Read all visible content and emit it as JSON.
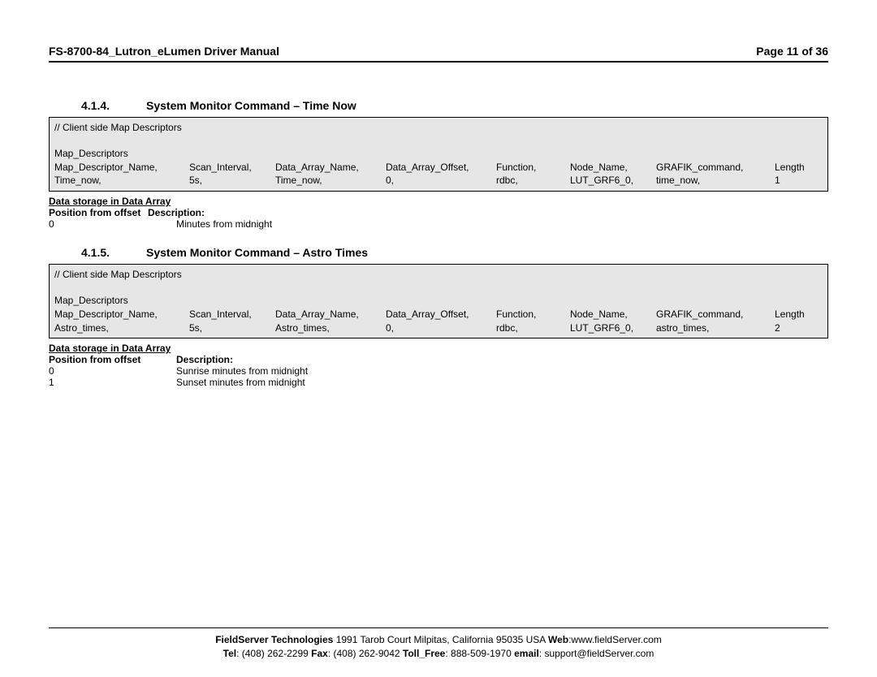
{
  "header": {
    "title": "FS-8700-84_Lutron_eLumen Driver Manual",
    "page": "Page 11 of 36"
  },
  "sections": [
    {
      "num": "4.1.4.",
      "title": "System Monitor Command – Time Now",
      "box": {
        "comment": "//   Client side Map Descriptors",
        "declare": "Map_Descriptors",
        "headers": [
          "Map_Descriptor_Name,",
          "Scan_Interval,",
          "Data_Array_Name,",
          "Data_Array_Offset,",
          "Function,",
          "Node_Name,",
          "GRAFIK_command,",
          "Length"
        ],
        "row": [
          "Time_now,",
          "5s,",
          "Time_now,",
          "0,",
          "rdbc,",
          "LUT_GRF6_0,",
          "time_now,",
          "1"
        ]
      },
      "storage": {
        "title": "Data storage in Data Array",
        "head": [
          "Position from offset",
          "Description"
        ],
        "rows": [
          [
            "0",
            "Minutes from midnight"
          ]
        ]
      }
    },
    {
      "num": "4.1.5.",
      "title": "System Monitor Command – Astro Times",
      "box": {
        "comment": "//   Client side Map Descriptors",
        "declare": "Map_Descriptors",
        "headers": [
          "Map_Descriptor_Name,",
          "Scan_Interval,",
          "Data_Array_Name,",
          "Data_Array_Offset,",
          "Function,",
          "Node_Name,",
          "GRAFIK_command,",
          "Length"
        ],
        "row": [
          "Astro_times,",
          "5s,",
          "Astro_times,",
          "0,",
          "rdbc,",
          "LUT_GRF6_0,",
          "astro_times,",
          "2"
        ]
      },
      "storage": {
        "title": "Data storage in Data Array",
        "head": [
          "Position from offset",
          "Description"
        ],
        "rows": [
          [
            "0",
            "Sunrise minutes from midnight"
          ],
          [
            "1",
            "Sunset minutes from midnight"
          ]
        ]
      }
    }
  ],
  "footer": {
    "line1_company": "FieldServer Technologies",
    "line1_addr": " 1991 Tarob Court Milpitas, California 95035 USA  ",
    "line1_web_l": "Web",
    "line1_web_v": ":www.fieldServer.com",
    "line2_tel_l": "Tel",
    "line2_tel_v": ": (408) 262-2299  ",
    "line2_fax_l": "Fax",
    "line2_fax_v": ": (408) 262-9042  ",
    "line2_tf_l": "Toll_Free",
    "line2_tf_v": ": 888-509-1970  ",
    "line2_em_l": "email",
    "line2_em_v": ": support@fieldServer.com"
  }
}
